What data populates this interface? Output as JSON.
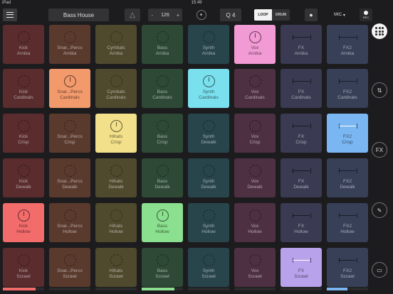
{
  "status": {
    "carrier": "iPad",
    "time": "15:49",
    "battery": ""
  },
  "toolbar": {
    "project_name": "Bass House",
    "tempo_minus": "-",
    "tempo": "126",
    "tempo_plus": "+",
    "quantize": "Q 4",
    "loop_label": "LOOP",
    "drum_label": "DRUM",
    "mic_label": "MIC",
    "rec_label": "REC",
    "metronome_glyph": "△",
    "mic_glyph": "●"
  },
  "colors": {
    "Kick": "#5a2c2e",
    "Snare": "#5b3a2e",
    "Cymbals": "#4f4a2e",
    "Bass": "#2e4a36",
    "Synth": "#28454c",
    "Vox": "#4d3042",
    "FX": "#3a3a52",
    "FX2": "#384058"
  },
  "columns": [
    {
      "name": "Kick",
      "lit_color": "#f26c6c",
      "bar_fill": 0.8,
      "bar_color": "#f26c6c",
      "pads": [
        {
          "l1": "Kick",
          "l2": "Arnika",
          "sym": "dashed"
        },
        {
          "l1": "Kick",
          "l2": "Cardinals",
          "sym": "dashed"
        },
        {
          "l1": "Kick",
          "l2": "Crisp",
          "sym": "dashed"
        },
        {
          "l1": "Kick",
          "l2": "Dewalk",
          "sym": "dashed"
        },
        {
          "l1": "Kick",
          "l2": "Hollow",
          "sym": "dashed",
          "lit": true
        },
        {
          "l1": "Kick",
          "l2": "Scrawl",
          "sym": "dashed"
        }
      ]
    },
    {
      "name": "Snare",
      "lit_color": "#f29a6c",
      "bar_fill": 0,
      "bar_color": "#f29a6c",
      "pads": [
        {
          "l1": "Snar...Percs",
          "l2": "Arnika",
          "sym": "dashed"
        },
        {
          "l1": "Snar...Percs",
          "l2": "Cardinals",
          "sym": "dashed",
          "lit": true
        },
        {
          "l1": "Snar...Percs",
          "l2": "Crisp",
          "sym": "dashed"
        },
        {
          "l1": "Snar...Percs",
          "l2": "Dewalk",
          "sym": "dashed"
        },
        {
          "l1": "Snar...Percs",
          "l2": "Hollow",
          "sym": "dashed"
        },
        {
          "l1": "Snar...Percs",
          "l2": "Scrawl",
          "sym": "dashed"
        }
      ]
    },
    {
      "name": "Cymbals",
      "lit_color": "#f2e08a",
      "bar_fill": 0,
      "bar_color": "#f2e08a",
      "pads": [
        {
          "l1": "Cymbals",
          "l2": "Arnika",
          "sym": "dashed"
        },
        {
          "l1": "Cymbals",
          "l2": "Cardinals",
          "sym": "dashed"
        },
        {
          "l1": "Hihats",
          "l2": "Crisp",
          "sym": "dashed",
          "lit": true
        },
        {
          "l1": "Hihats",
          "l2": "Dewalk",
          "sym": "dashed"
        },
        {
          "l1": "Hihats",
          "l2": "Hollow",
          "sym": "dashed"
        },
        {
          "l1": "Hihats",
          "l2": "Scrawl",
          "sym": "dashed"
        }
      ]
    },
    {
      "name": "Bass",
      "lit_color": "#8ae08e",
      "bar_fill": 0.8,
      "bar_color": "#8ae08e",
      "pads": [
        {
          "l1": "Bass",
          "l2": "Arnika",
          "sym": "dashed"
        },
        {
          "l1": "Bass",
          "l2": "Cardinals",
          "sym": "dashed"
        },
        {
          "l1": "Bass",
          "l2": "Crisp",
          "sym": "dashed"
        },
        {
          "l1": "Bass",
          "l2": "Dewalk",
          "sym": "dashed"
        },
        {
          "l1": "Bass",
          "l2": "Hollow",
          "sym": "dashed",
          "lit": true
        },
        {
          "l1": "Bass",
          "l2": "Scrawl",
          "sym": "dashed"
        }
      ]
    },
    {
      "name": "Synth",
      "lit_color": "#7ae0ee",
      "bar_fill": 0,
      "bar_color": "#7ae0ee",
      "pads": [
        {
          "l1": "Synth",
          "l2": "Arnika",
          "sym": "dashed"
        },
        {
          "l1": "Synth",
          "l2": "Cardinals",
          "sym": "dashed",
          "lit": true
        },
        {
          "l1": "Synth",
          "l2": "Dewalk",
          "sym": "dashed"
        },
        {
          "l1": "Synth",
          "l2": "Dewalk",
          "sym": "dashed"
        },
        {
          "l1": "Synth",
          "l2": "Hollow",
          "sym": "dashed"
        },
        {
          "l1": "Synth",
          "l2": "Scrawl",
          "sym": "dashed"
        }
      ]
    },
    {
      "name": "Vox",
      "lit_color": "#f29ad4",
      "bar_fill": 0,
      "bar_color": "#f29ad4",
      "pads": [
        {
          "l1": "Vox",
          "l2": "Arnika",
          "sym": "dashed",
          "lit": true
        },
        {
          "l1": "Vox",
          "l2": "Cardinals",
          "sym": "dashed"
        },
        {
          "l1": "Vox",
          "l2": "Crisp",
          "sym": "dashed"
        },
        {
          "l1": "Vox",
          "l2": "Dewalk",
          "sym": "dashed"
        },
        {
          "l1": "Vox",
          "l2": "Hollow",
          "sym": "dashed"
        },
        {
          "l1": "Vox",
          "l2": "Scrawl",
          "sym": "dashed"
        }
      ]
    },
    {
      "name": "FX",
      "lit_color": "#b9a2ec",
      "bar_fill": 0,
      "bar_color": "#b9a2ec",
      "pads": [
        {
          "l1": "FX",
          "l2": "Arnika",
          "sym": "fxbar"
        },
        {
          "l1": "FX",
          "l2": "Cardinals",
          "sym": "fxbar"
        },
        {
          "l1": "FX",
          "l2": "Crisp",
          "sym": "fxbar"
        },
        {
          "l1": "FX",
          "l2": "Dewalk",
          "sym": "fxbar"
        },
        {
          "l1": "FX",
          "l2": "Hollow",
          "sym": "fxbar"
        },
        {
          "l1": "FX",
          "l2": "Scrawl",
          "sym": "fxbar",
          "lit": true
        }
      ]
    },
    {
      "name": "FX2",
      "lit_color": "#7ab6f2",
      "bar_fill": 0.5,
      "bar_color": "#7ab6f2",
      "pads": [
        {
          "l1": "FX2",
          "l2": "Arnika",
          "sym": "fxbar"
        },
        {
          "l1": "FX2",
          "l2": "Cardinals",
          "sym": "fxbar"
        },
        {
          "l1": "FX2",
          "l2": "Crisp",
          "sym": "fxbar",
          "lit": true
        },
        {
          "l1": "FX2",
          "l2": "Dewalk",
          "sym": "fxbar"
        },
        {
          "l1": "FX2",
          "l2": "Hollow",
          "sym": "fxbar"
        },
        {
          "l1": "FX2",
          "l2": "Scrawl",
          "sym": "fxbar"
        }
      ]
    }
  ],
  "sidebar": [
    {
      "name": "pads-view",
      "icon": "grid-icon"
    },
    {
      "name": "mixer",
      "icon": "sliders-icon",
      "glyph": "⇅"
    },
    {
      "name": "fx",
      "icon": "fx-icon",
      "glyph": "FX"
    },
    {
      "name": "edit",
      "icon": "edit-icon",
      "glyph": "✎"
    },
    {
      "name": "library",
      "icon": "folder-icon",
      "glyph": "▭"
    }
  ]
}
